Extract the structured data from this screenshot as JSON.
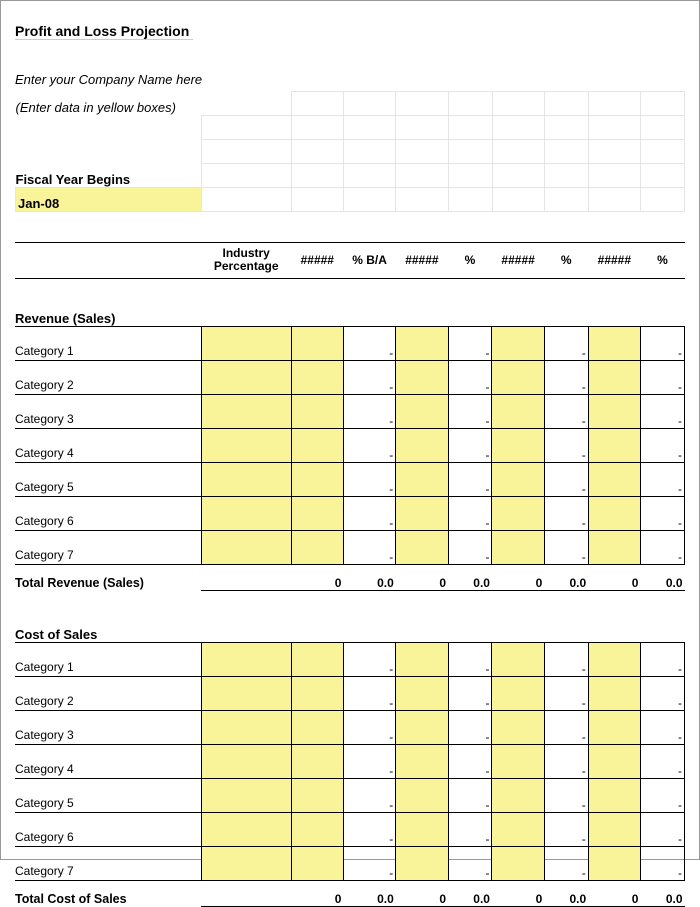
{
  "title": "Profit and Loss Projection",
  "company_placeholder": "Enter your Company Name here",
  "hint": "(Enter data in yellow boxes)",
  "fiscal_year_label": "Fiscal Year Begins",
  "fiscal_year_value": "Jan-08",
  "columns": [
    "Industry Percentage",
    "#####",
    "% B/A",
    "#####",
    "%",
    "#####",
    "%",
    "#####",
    "%"
  ],
  "revenue": {
    "header": "Revenue (Sales)",
    "categories": [
      "Category 1",
      "Category 2",
      "Category 3",
      "Category 4",
      "Category 5",
      "Category 6",
      "Category 7"
    ],
    "row_dash": "-",
    "total_label": "Total Revenue (Sales)",
    "totals": [
      "",
      "0",
      "0.0",
      "0",
      "0.0",
      "0",
      "0.0",
      "0",
      "0.0"
    ]
  },
  "cost": {
    "header": "Cost of Sales",
    "categories": [
      "Category 1",
      "Category 2",
      "Category 3",
      "Category 4",
      "Category 5",
      "Category 6",
      "Category 7"
    ],
    "row_dash": "-",
    "total_label": "Total Cost of Sales",
    "totals": [
      "",
      "0",
      "0.0",
      "0",
      "0.0",
      "0",
      "0.0",
      "0",
      "0.0"
    ]
  }
}
